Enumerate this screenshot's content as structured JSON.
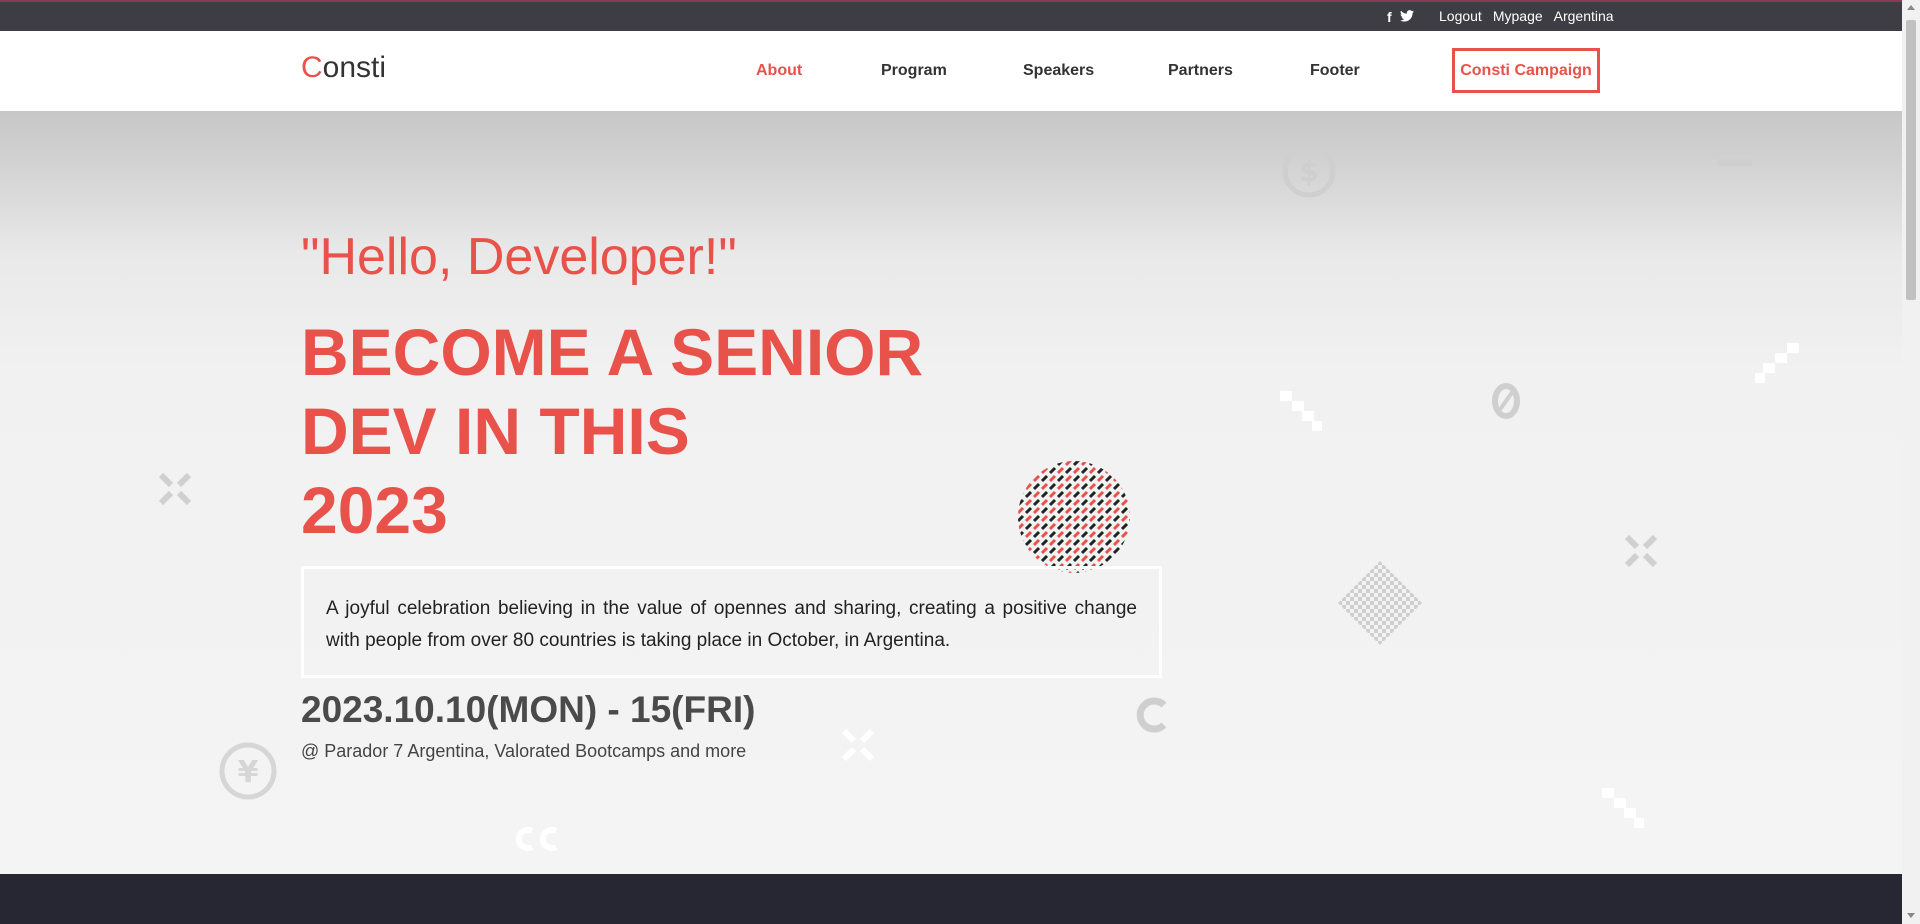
{
  "topbar": {
    "social": [
      "f",
      "t"
    ],
    "links": [
      "Logout",
      "Mypage",
      "Argentina"
    ]
  },
  "header": {
    "logo_first": "C",
    "logo_rest": "onsti",
    "nav": [
      "About",
      "Program",
      "Speakers",
      "Partners",
      "Footer"
    ],
    "active_nav": "About",
    "campaign_label": "Consti Campaign"
  },
  "hero": {
    "greeting": "\"Hello, Developer!\"",
    "headline": [
      "BECOME A SENIOR",
      "DEV IN THIS",
      "2023"
    ],
    "description": "A joyful celebration believing in the value of opennes and sharing, creating a positive change with people from over 80 countries is taking place in October, in Argentina.",
    "date": "2023.10.10(MON) - 15(FRI)",
    "venue": "@ Parador 7 Argentina, Valorated Bootcamps and more"
  },
  "decor": {
    "icons": [
      "dollar-coin-icon",
      "yen-coin-icon",
      "equals-icon",
      "close-x-icon",
      "diamond-grid-icon",
      "zero-glyph-icon",
      "c-glyph-icon",
      "checker-step-icon"
    ]
  },
  "colors": {
    "accent": "#e8524a",
    "topbar": "#3f3d44",
    "dark_band": "#262733"
  }
}
